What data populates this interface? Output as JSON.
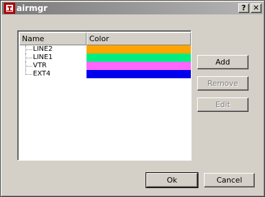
{
  "window": {
    "title": "airmgr",
    "help_glyph": "?",
    "close_glyph": "✕"
  },
  "table": {
    "columns": [
      "Name",
      "Color"
    ],
    "rows": [
      {
        "name": "LINE2",
        "color": "#ffa500"
      },
      {
        "name": "LINE1",
        "color": "#00ee80"
      },
      {
        "name": "VTR",
        "color": "#ff66ff"
      },
      {
        "name": "EXT4",
        "color": "#0000ee"
      }
    ]
  },
  "buttons": {
    "add": "Add",
    "remove": "Remove",
    "edit": "Edit",
    "ok": "Ok",
    "cancel": "Cancel"
  },
  "colors": {
    "titlebar_start": "#7a7a7a",
    "titlebar_end": "#b6b6b6",
    "app_icon_red": "#c00000"
  },
  "icons": {
    "app": "app-icon",
    "help": "help-icon",
    "close": "close-icon"
  }
}
